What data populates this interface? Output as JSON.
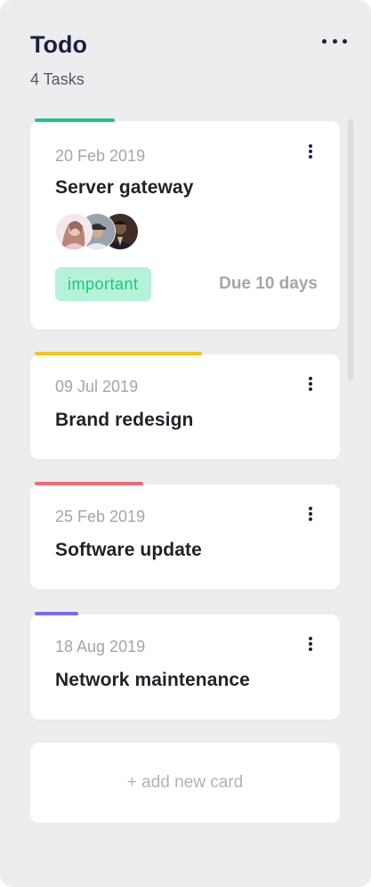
{
  "column": {
    "title": "Todo",
    "count_label": "4 Tasks",
    "menu_icon": "more-horizontal-icon"
  },
  "cards": [
    {
      "date": "20 Feb 2019",
      "title": "Server gateway",
      "accent_color": "#1ec787",
      "accent_fraction": 0.26,
      "tag": "important",
      "due": "Due 10 days",
      "avatars": [
        "avatar-woman",
        "avatar-man-cap",
        "avatar-man-suit"
      ]
    },
    {
      "date": "09 Jul 2019",
      "title": "Brand redesign",
      "accent_color": "#f5c518",
      "accent_fraction": 0.54
    },
    {
      "date": "25 Feb 2019",
      "title": "Software update",
      "accent_color": "#ef6b73",
      "accent_fraction": 0.35
    },
    {
      "date": "18 Aug 2019",
      "title": "Network maintenance",
      "accent_color": "#7a6cf0",
      "accent_fraction": 0.14
    }
  ],
  "add_card_label": "+ add new card",
  "colors": {
    "column_bg": "#ededf0",
    "title": "#1b2140",
    "tag_bg": "#b5f2d8",
    "tag_text": "#1bc77f",
    "muted": "#a3a6ad"
  }
}
